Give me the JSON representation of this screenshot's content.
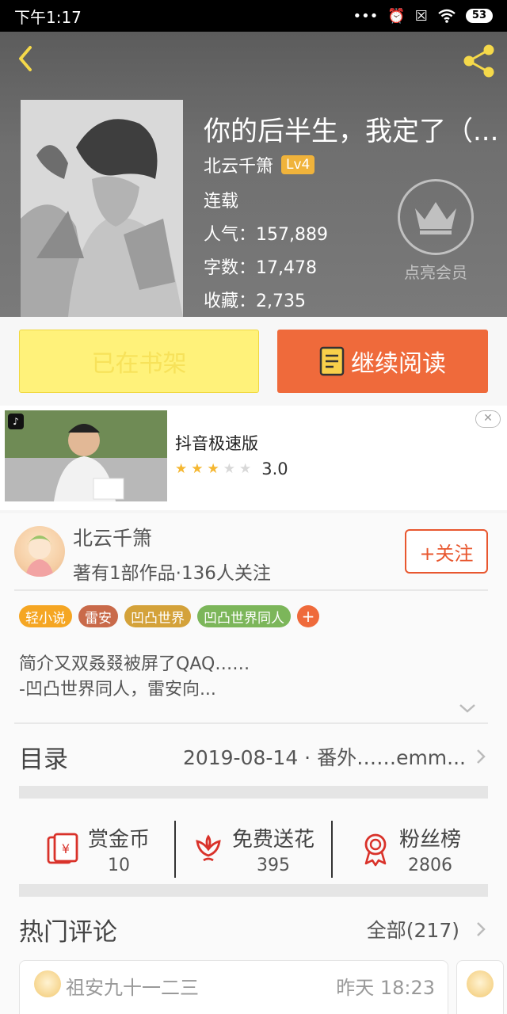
{
  "status_bar": {
    "time": "下午1:17",
    "battery": "53"
  },
  "book": {
    "title": "你的后半生，我定了（...",
    "author": "北云千箫",
    "level": "Lv4",
    "status": "连载",
    "popularity": "人气：157,889",
    "word_count": "字数：17,478",
    "favorites": "收藏：2,735",
    "vip_label": "点亮会员"
  },
  "actions": {
    "shelf_label": "已在书架",
    "read_label": "继续阅读"
  },
  "ad": {
    "title": "抖音极速版",
    "rating": 3,
    "score": "3.0",
    "close": "✕"
  },
  "author_card": {
    "name": "北云千箫",
    "subtitle": "著有1部作品·136人关注",
    "follow_label": "+关注",
    "tags": [
      {
        "label": "轻小说",
        "color": "#f5a623"
      },
      {
        "label": "雷安",
        "color": "#c96a4a"
      },
      {
        "label": "凹凸世界",
        "color": "#d4a23a"
      },
      {
        "label": "凹凸世界同人",
        "color": "#7cb65a"
      }
    ],
    "tag_add": "+",
    "intro_line1": "简介又双叒叕被屏了QAQ……",
    "intro_line2": "-凹凸世界同人，雷安向..."
  },
  "toc": {
    "label": "目录",
    "latest": "2019-08-14 · 番外……emm..."
  },
  "stats": [
    {
      "label": "赏金币",
      "value": "10",
      "icon": "money-envelope-icon"
    },
    {
      "label": "免费送花",
      "value": "395",
      "icon": "flower-icon"
    },
    {
      "label": "粉丝榜",
      "value": "2806",
      "icon": "medal-icon"
    }
  ],
  "comments": {
    "title": "热门评论",
    "all_label": "全部(217)",
    "first": {
      "user": "祖安九十一二三",
      "time": "昨天 18:23"
    }
  },
  "colors": {
    "accent": "#ef6a3b",
    "shelf_bg": "#fff27a",
    "level_badge": "#f0b33b",
    "icon_red": "#d9322a"
  }
}
